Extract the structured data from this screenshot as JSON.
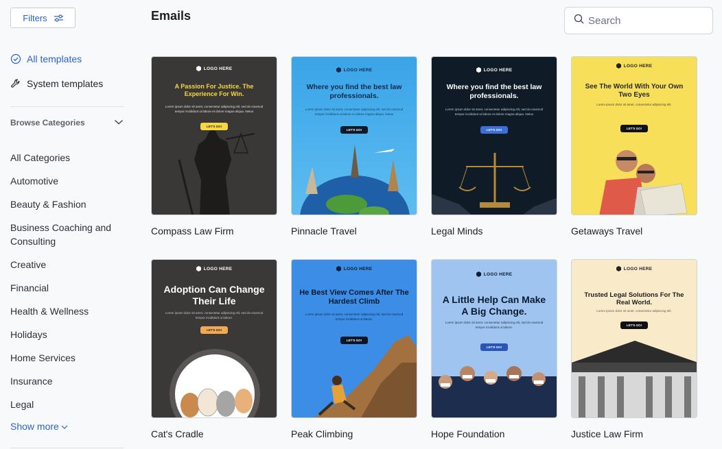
{
  "sidebar": {
    "filters_label": "Filters",
    "all_templates": "All templates",
    "system_templates": "System templates",
    "browse_categories": "Browse Categories",
    "categories": [
      "All Categories",
      "Automotive",
      "Beauty & Fashion",
      "Business Coaching and Consulting",
      "Creative",
      "Financial",
      "Health & Wellness",
      "Holidays",
      "Home Services",
      "Insurance",
      "Legal"
    ],
    "show_more": "Show more"
  },
  "main": {
    "title": "Emails",
    "search_placeholder": "Search"
  },
  "templates": [
    {
      "name": "Compass Law Firm",
      "logo": "LOGO HERE",
      "headline": "A Passion For Justice. The Experience For Win.",
      "body": "Lorem ipsum dolor sit amet, consectetur adipiscing elit, sed do eiusmod tempor incididunt ut labore et dolore magna aliqua. Netus",
      "button": "LET'S GO!"
    },
    {
      "name": "Pinnacle Travel",
      "logo": "LOGO HERE",
      "headline": "Where you find the best law professionals.",
      "body": "Lorem ipsum dolor sit amet, consectetur adipiscing elit, sed do eiusmod tempor incididunt ut labore et dolore magna aliqua. Netus",
      "button": "LET'S GO!"
    },
    {
      "name": "Legal Minds",
      "logo": "LOGO HERE",
      "headline": "Where you find the best law professionals.",
      "body": "Lorem ipsum dolor sit amet, consectetur adipiscing elit, sed do eiusmod tempor incididunt ut labore et dolore magna aliqua. Netus",
      "button": "LET'S GO!"
    },
    {
      "name": "Getaways Travel",
      "logo": "LOGO HERE",
      "headline": "See The World With Your Own Two Eyes",
      "body": "Lorem ipsum dolor sit amet, consectetur adipiscing elit.",
      "button": "LET'S GO!"
    },
    {
      "name": "Cat's Cradle",
      "logo": "LOGO HERE",
      "headline": "Adoption Can Change Their Life",
      "body": "Lorem ipsum dolor sit amet, consectetur adipiscing elit, sed do eiusmod tempor incididunt ut labore.",
      "button": "LET'S GO!"
    },
    {
      "name": "Peak Climbing",
      "logo": "LOGO HERE",
      "headline": "He Best View Comes After The Hardest Climb",
      "body": "Lorem ipsum dolor sit amet, consectetur adipiscing elit, sed do eiusmod tempor incididunt ut labore.",
      "button": "LET'S GO!"
    },
    {
      "name": "Hope Foundation",
      "logo": "LOGO HERE",
      "headline": "A Little Help Can Make A Big Change.",
      "body": "Lorem ipsum dolor sit amet, consectetur adipiscing elit, sed do eiusmod tempor incididunt ut labore.",
      "button": "LET'S GO!"
    },
    {
      "name": "Justice Law Firm",
      "logo": "LOGO HERE",
      "headline": "Trusted Legal Solutions For The Real World.",
      "body": "Lorem ipsum dolor sit amet, consectetur adipiscing elit.",
      "button": "LET'S GO!"
    }
  ],
  "colors": {
    "accent": "#2a62c9",
    "page_bg": "#f8f9fb"
  }
}
